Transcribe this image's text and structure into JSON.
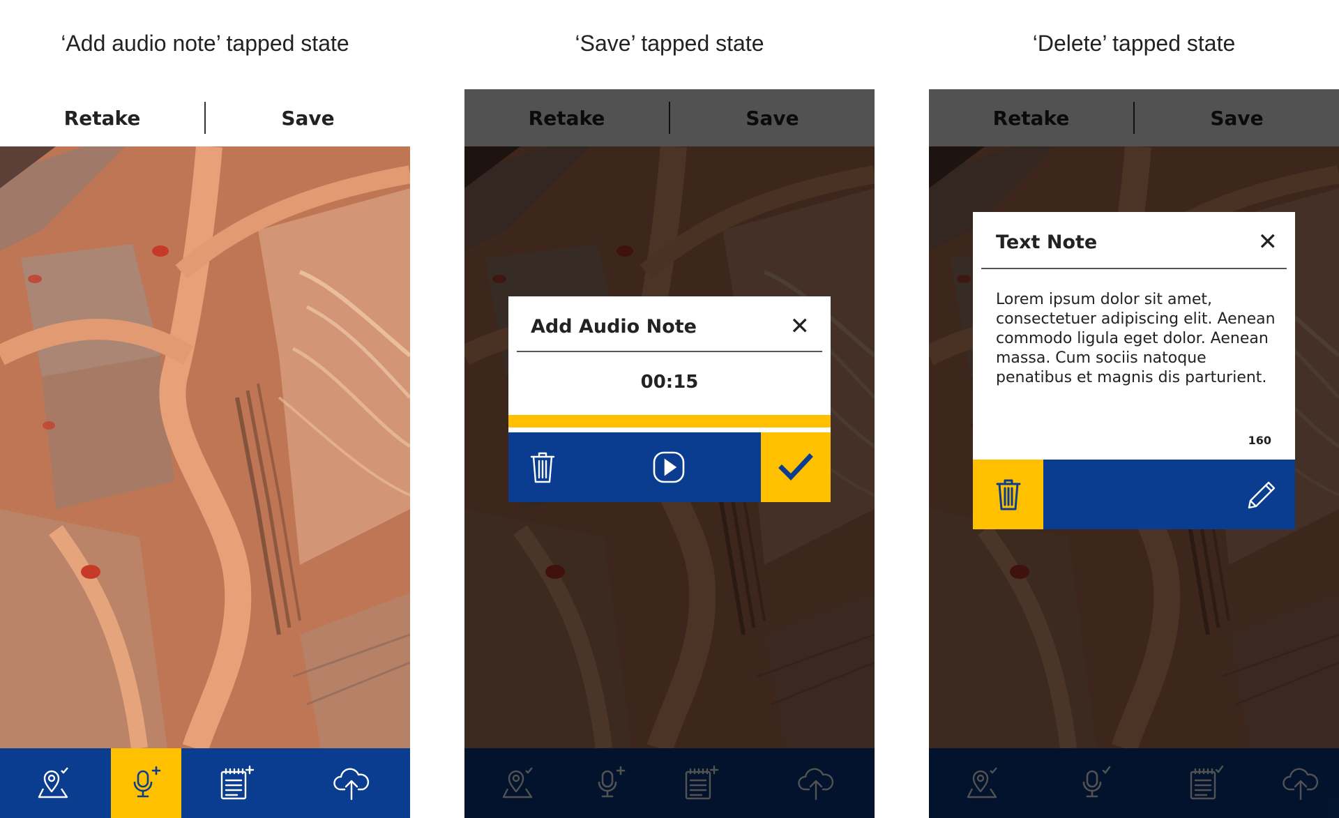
{
  "captions": [
    "‘Add audio note’ tapped state",
    "‘Save’ tapped state",
    "‘Delete’ tapped state"
  ],
  "topbar": {
    "retake_label": "Retake",
    "save_label": "Save"
  },
  "bottom_tabs": [
    {
      "icon": "map-pin-check-icon"
    },
    {
      "icon": "microphone-add-icon"
    },
    {
      "icon": "notepad-add-icon"
    },
    {
      "icon": "cloud-upload-icon"
    }
  ],
  "audio_dialog": {
    "title": "Add Audio Note",
    "timer": "00:15",
    "progress": 1.0,
    "close_icon": "close-icon",
    "delete_icon": "trash-icon",
    "play_icon": "play-icon",
    "confirm_icon": "checkmark-icon"
  },
  "text_dialog": {
    "title": "Text Note",
    "body": "Lorem ipsum dolor sit amet, consectetuer adipiscing elit. Aenean commodo ligula eget dolor. Aenean massa. Cum sociis natoque penatibus et magnis dis parturient.",
    "char_count": "160",
    "close_icon": "close-icon",
    "delete_icon": "trash-icon",
    "edit_icon": "pencil-icon"
  },
  "colors": {
    "brand_blue": "#0a3d8f",
    "accent_yellow": "#ffc000",
    "dim_overlay": "rgba(0,0,0,0.68)"
  }
}
